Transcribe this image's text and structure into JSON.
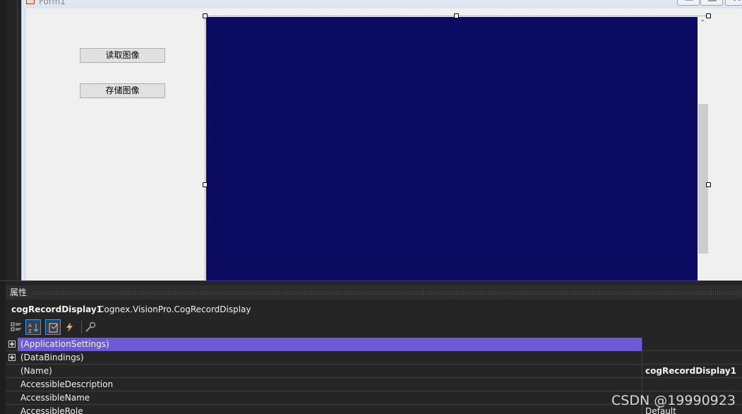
{
  "form": {
    "title": "Form1",
    "read_image_label": "读取图像",
    "save_image_label": "存储图像"
  },
  "properties": {
    "panel_title": "属性",
    "object_name": "cogRecordDisplay1",
    "object_type": "Cognex.VisionPro.CogRecordDisplay",
    "toolbar": [
      "categorized-icon",
      "alphabetical-icon",
      "properties-icon",
      "events-icon",
      "property-pages-icon"
    ],
    "rows": [
      {
        "name": "(ApplicationSettings)",
        "value": "",
        "expandable": true,
        "selected": true
      },
      {
        "name": "(DataBindings)",
        "value": "",
        "expandable": true,
        "selected": false
      },
      {
        "name": "(Name)",
        "value": "cogRecordDisplay1",
        "expandable": false,
        "selected": false,
        "bold_value": true
      },
      {
        "name": "AccessibleDescription",
        "value": "",
        "expandable": false,
        "selected": false
      },
      {
        "name": "AccessibleName",
        "value": "",
        "expandable": false,
        "selected": false
      },
      {
        "name": "AccessibleRole",
        "value": "Default",
        "expandable": false,
        "selected": false
      }
    ]
  },
  "colors": {
    "display_background": "#0c0b62",
    "selection_highlight": "#6f5ad6",
    "panel_background": "#252526"
  },
  "watermark": "CSDN @19990923"
}
